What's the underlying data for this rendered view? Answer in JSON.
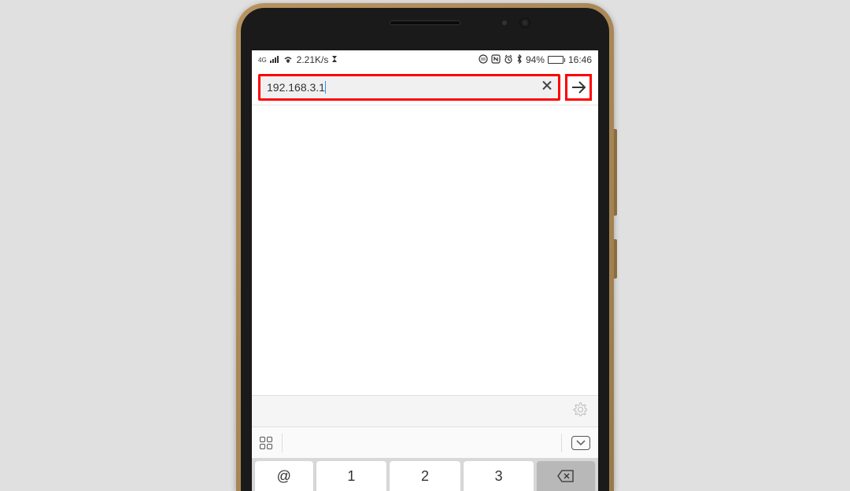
{
  "status_bar": {
    "network_label": "4G",
    "data_speed": "2.21K/s",
    "battery_pct": "94%",
    "time": "16:46"
  },
  "browser": {
    "url_value": "192.168.3.1"
  },
  "keyboard": {
    "keys": [
      "@",
      "1",
      "2",
      "3"
    ]
  }
}
